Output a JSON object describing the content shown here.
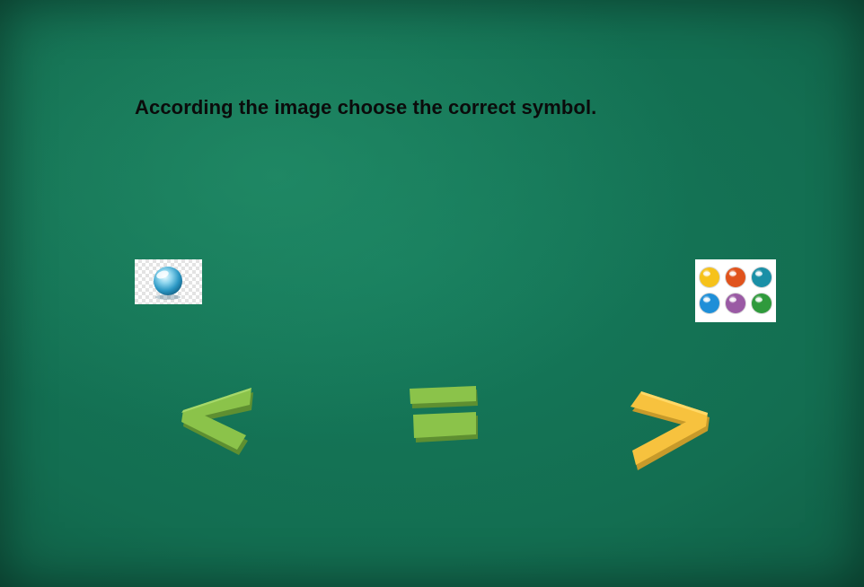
{
  "question": {
    "text": "According the image choose the correct symbol."
  },
  "left_image": {
    "icon": "single-water-drop-ball-icon",
    "count": 1
  },
  "right_image": {
    "icon": "colored-balls-icon",
    "count": 6,
    "ball_colors": [
      "#f6c21b",
      "#e0531d",
      "#1a8fa6",
      "#1f8fd8",
      "#9a5aa4",
      "#2f9a3c"
    ]
  },
  "choices": [
    {
      "id": "less",
      "icon": "less-than-icon",
      "color": "#8bc34a"
    },
    {
      "id": "equal",
      "icon": "equals-icon",
      "color": "#8bc34a"
    },
    {
      "id": "greater",
      "icon": "greater-than-icon",
      "color": "#f7c23e"
    }
  ],
  "colors": {
    "board": "#136e51",
    "question_text": "#0b0b0b",
    "green_symbol": "#8bc34a",
    "yellow_symbol": "#f7c23e"
  }
}
